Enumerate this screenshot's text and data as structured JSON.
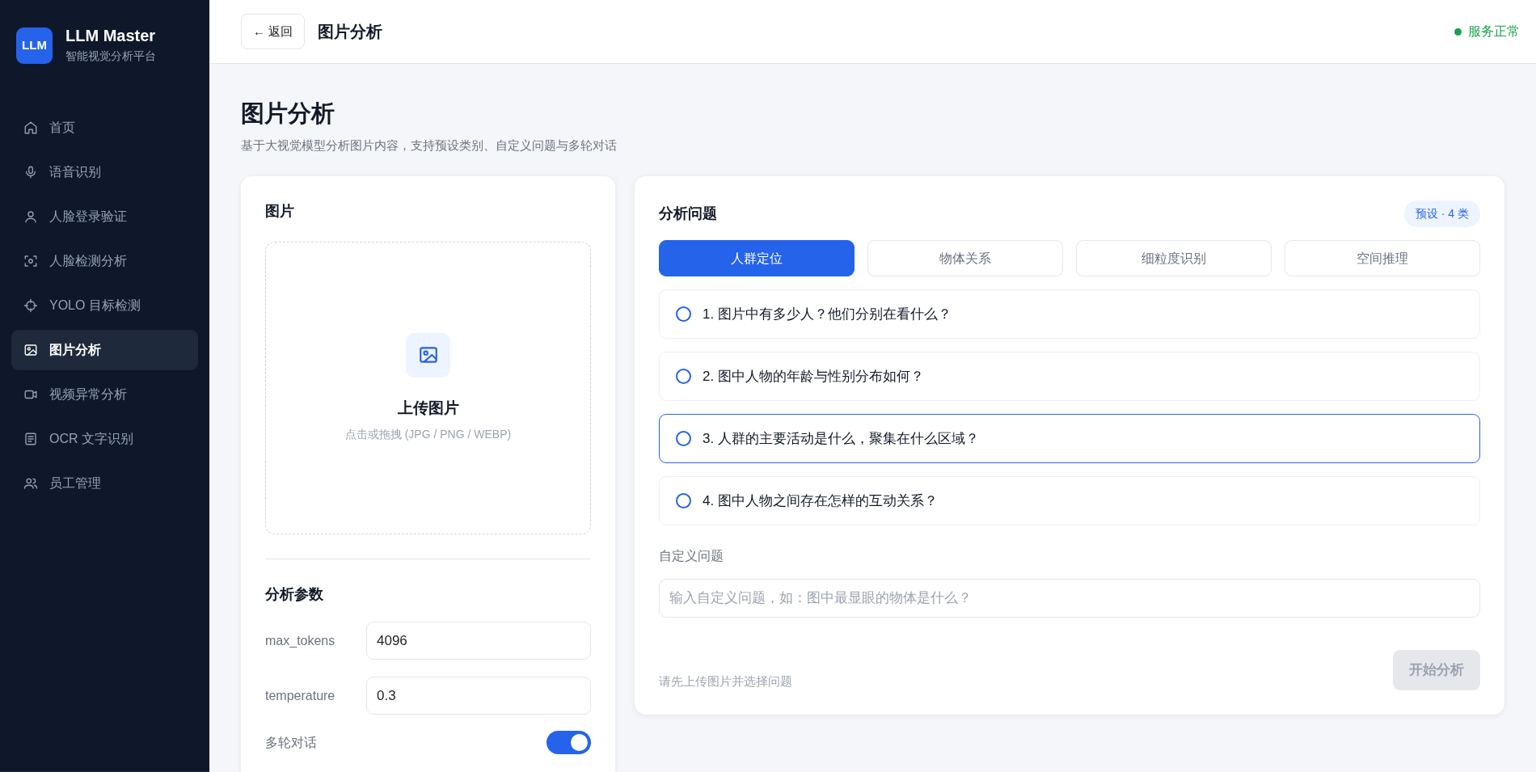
{
  "sidebar": {
    "logo": "LLM",
    "title": "LLM Master",
    "subtitle": "智能视觉分析平台",
    "items": [
      {
        "label": "首页",
        "selected": false
      },
      {
        "label": "语音识别",
        "selected": false
      },
      {
        "label": "人脸登录验证",
        "selected": false
      },
      {
        "label": "人脸检测分析",
        "selected": false
      },
      {
        "label": "YOLO 目标检测",
        "selected": false
      },
      {
        "label": "图片分析",
        "selected": true
      },
      {
        "label": "视频异常分析",
        "selected": false
      },
      {
        "label": "OCR 文字识别",
        "selected": false
      },
      {
        "label": "员工管理",
        "selected": false
      }
    ]
  },
  "topbar": {
    "back": "← 返回",
    "title": "图片分析",
    "status": "服务正常",
    "status_ok": true
  },
  "page": {
    "title": "图片分析",
    "subtitle": "基于大视觉模型分析图片内容，支持预设类别、自定义问题与多轮对话"
  },
  "image_card": {
    "title": "图片",
    "upload_title": "上传图片",
    "upload_hint": "点击或拖拽 (JPG / PNG / WEBP)",
    "params_title": "分析参数",
    "params": [
      {
        "label": "max_tokens",
        "value": "4096"
      },
      {
        "label": "temperature",
        "value": "0.3"
      }
    ],
    "multi_turn": {
      "label": "多轮对话",
      "on": true
    }
  },
  "question_card": {
    "title": "分析问题",
    "badge": "预设 · 4 类",
    "tabs": [
      {
        "label": "人群定位",
        "selected": true
      },
      {
        "label": "物体关系",
        "selected": false
      },
      {
        "label": "细粒度识别",
        "selected": false
      },
      {
        "label": "空间推理",
        "selected": false
      }
    ],
    "questions": [
      {
        "text": "1. 图片中有多少人？他们分别在看什么？",
        "selected": false,
        "highlighted": false
      },
      {
        "text": "2. 图中人物的年龄与性别分布如何？",
        "selected": false,
        "highlighted": false
      },
      {
        "text": "3. 人群的主要活动是什么，聚集在什么区域？",
        "selected": false,
        "highlighted": true
      },
      {
        "text": "4. 图中人物之间存在怎样的互动关系？",
        "selected": false,
        "highlighted": false
      }
    ],
    "custom_label": "自定义问题",
    "custom_placeholder": "输入自定义问题，如：图中最显眼的物体是什么？",
    "hint": "请先上传图片并选择问题",
    "start": {
      "label": "开始分析",
      "disabled": true
    }
  }
}
